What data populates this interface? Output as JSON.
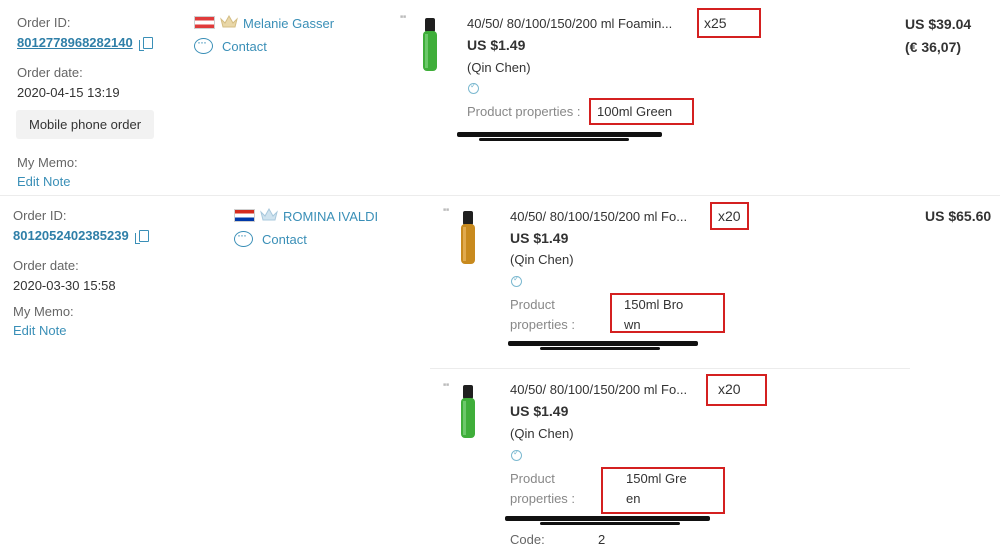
{
  "orders": [
    {
      "order_id_label": "Order ID:",
      "order_id": "8012778968282140",
      "order_date_label": "Order date:",
      "order_date": "2020-04-15 13:19",
      "badge": "Mobile phone order",
      "memo_label": "My Memo:",
      "memo_action": "Edit Note",
      "buyer_name": "Melanie Gasser",
      "contact_label": "Contact",
      "total": "US $39.04",
      "total_alt": "(€ 36,07)",
      "items": [
        {
          "title": "40/50/ 80/100/150/200 ml Foamin...",
          "price": "US $1.49",
          "seller": "(Qin Chen)",
          "qty": "x25",
          "prop_label": "Product properties :",
          "prop_value": "100ml Green"
        }
      ]
    },
    {
      "order_id_label": "Order ID:",
      "order_id": "8012052402385239",
      "order_date_label": "Order date:",
      "order_date": "2020-03-30 15:58",
      "memo_label": "My Memo:",
      "memo_action": "Edit Note",
      "buyer_name": "ROMINA IVALDI",
      "contact_label": "Contact",
      "total": "US $65.60",
      "items": [
        {
          "title": "40/50/ 80/100/150/200 ml Fo...",
          "price": "US $1.49",
          "seller": "(Qin Chen)",
          "qty": "x20",
          "prop_label_1": "Product",
          "prop_label_2": "properties :",
          "prop_value_1": "150ml Bro",
          "prop_value_2": "wn"
        },
        {
          "title": "40/50/ 80/100/150/200 ml Fo...",
          "price": "US $1.49",
          "seller": "(Qin Chen)",
          "qty": "x20",
          "prop_label_1": "Product",
          "prop_label_2": "properties :",
          "prop_value_1": "150ml Gre",
          "prop_value_2": "en",
          "code_label": "Code:",
          "code_value": "2"
        }
      ]
    }
  ],
  "icons": {
    "copy": "copy-icon",
    "chat": "chat-icon",
    "crown": "crown-icon",
    "verified": "shield-check-icon"
  },
  "colors": {
    "link": "#3a8fb7",
    "highlight_box": "#d42020",
    "bottle_green": "#3fae3a",
    "bottle_brown": "#c88a1e"
  }
}
